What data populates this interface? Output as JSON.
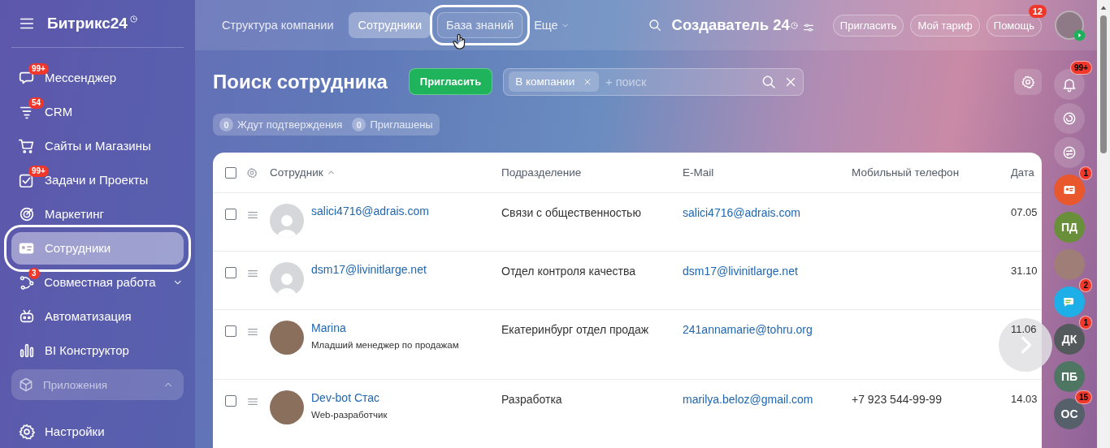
{
  "sidebar": {
    "logo": "Битрикс24",
    "items": [
      {
        "label": "Мессенджер",
        "kind": "messenger",
        "badge": "99+",
        "selected": false
      },
      {
        "label": "CRM",
        "kind": "crm",
        "badge": "54",
        "selected": false
      },
      {
        "label": "Сайты и Магазины",
        "kind": "shop",
        "selected": false
      },
      {
        "label": "Задачи и Проекты",
        "kind": "tasks",
        "badge": "99+",
        "selected": false
      },
      {
        "label": "Маркетинг",
        "kind": "marketing",
        "selected": false
      },
      {
        "label": "Сотрудники",
        "kind": "employees",
        "selected": true
      },
      {
        "label": "Совместная работа",
        "kind": "collab",
        "badge": "3",
        "selected": false,
        "expanded": false
      },
      {
        "label": "Автоматизация",
        "kind": "automation",
        "selected": false
      },
      {
        "label": "BI Конструктор",
        "kind": "bi",
        "selected": false
      }
    ],
    "apps": {
      "label": "Приложения",
      "expanded": true
    },
    "settings": {
      "label": "Настройки"
    }
  },
  "topbar": {
    "tabs": [
      {
        "label": "Структура компании",
        "selected": false,
        "hovered": false
      },
      {
        "label": "Сотрудники",
        "selected": true,
        "hovered": false
      },
      {
        "label": "База знаний",
        "selected": false,
        "hovered": true
      }
    ],
    "more": {
      "label": "Еще"
    },
    "portal_title": "Создаватель 24",
    "buttons": [
      {
        "label": "Пригласить"
      },
      {
        "label": "Мой тариф"
      },
      {
        "label": "Помощь",
        "badge": "12"
      }
    ]
  },
  "page": {
    "title": "Поиск сотрудника",
    "invite_button": "Пригласить",
    "filter": {
      "chip": "В компании",
      "placeholder": "+ поиск"
    },
    "counters": [
      {
        "count": "0",
        "label": "Ждут подтверждения"
      },
      {
        "count": "0",
        "label": "Приглашены"
      }
    ]
  },
  "table": {
    "header_checked": false,
    "columns": [
      {
        "label": "Сотрудник",
        "sorted": true
      },
      {
        "label": "Подразделение",
        "sorted": false
      },
      {
        "label": "E-Mail",
        "sorted": false
      },
      {
        "label": "Мобильный телефон",
        "sorted": false
      },
      {
        "label": "Дата",
        "sorted": false
      }
    ],
    "rows": [
      {
        "checked": false,
        "photo": false,
        "name": "salici4716@adrais.com",
        "department": "Связи с общественностью",
        "email": "salici4716@adrais.com",
        "date": "07.05"
      },
      {
        "checked": false,
        "photo": false,
        "name": "dsm17@livinitlarge.net",
        "department": "Отдел контроля качества",
        "email": "dsm17@livinitlarge.net",
        "date": "31.10"
      },
      {
        "checked": false,
        "photo": true,
        "name": "Marina",
        "position": "Младший менеджер по продажам",
        "department": "Екатеринбург отдел продаж",
        "email": "241annamarie@tohru.org",
        "date": "11.06"
      },
      {
        "checked": false,
        "photo": true,
        "name": "Dev-bot Стас",
        "position": "Web-разработчик",
        "department": "Разработка",
        "email": "marilya.beloz@gmail.com",
        "phone": "+7 923 544-99-99",
        "date": "14.03"
      }
    ]
  },
  "rail": [
    {
      "kind": "bell",
      "badge": "99+"
    },
    {
      "kind": "target"
    },
    {
      "kind": "swap"
    },
    {
      "kind": "contacts",
      "badge": "1",
      "color": "#e9572d"
    },
    {
      "kind": "initials",
      "text": "ПД",
      "color": "#6a8f3a"
    },
    {
      "kind": "photo"
    },
    {
      "kind": "chat",
      "badge": "2",
      "color": "#1eaee8"
    },
    {
      "kind": "initials",
      "text": "ДК",
      "badge": "1",
      "color": "#54595c"
    },
    {
      "kind": "initials",
      "text": "ПБ",
      "color": "#4f7563"
    },
    {
      "kind": "initials",
      "text": "ОС",
      "badge": "15",
      "color": "#56606a"
    }
  ]
}
